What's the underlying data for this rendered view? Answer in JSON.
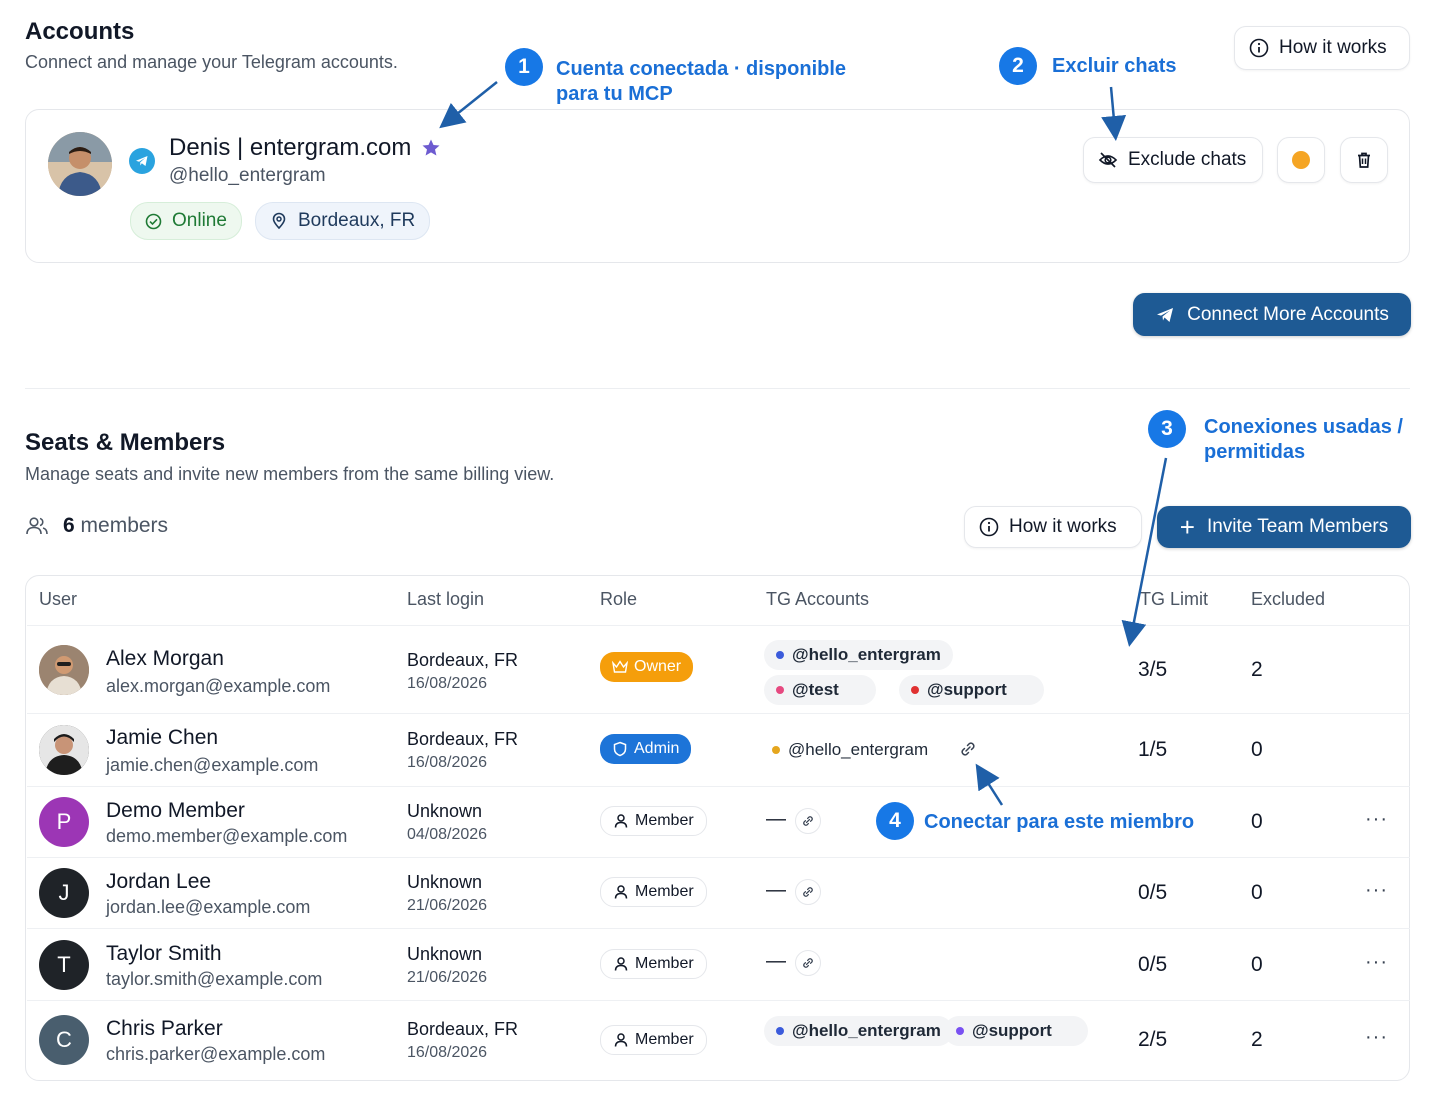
{
  "accounts": {
    "title": "Accounts",
    "subtitle": "Connect and manage your Telegram accounts.",
    "how_it_works": "How it works",
    "account": {
      "name": "Denis | entergram.com",
      "handle": "@hello_entergram",
      "status": "Online",
      "location": "Bordeaux, FR",
      "exclude_label": "Exclude chats",
      "status_color": "#f59e0b"
    },
    "connect_more": "Connect More Accounts"
  },
  "annotations": {
    "a1": {
      "num": "1",
      "line1": "Cuenta conectada · disponible",
      "line2": "para tu MCP"
    },
    "a2": {
      "num": "2",
      "line1": "Excluir chats"
    },
    "a3": {
      "num": "3",
      "line1": "Conexiones usadas /",
      "line2": "permitidas"
    },
    "a4": {
      "num": "4",
      "line1": "Conectar para este miembro"
    }
  },
  "seats": {
    "title": "Seats & Members",
    "subtitle": "Manage seats and invite new members from the same billing view.",
    "member_count": "6",
    "member_label": "members",
    "how_it_works": "How it works",
    "invite": "Invite Team Members",
    "columns": {
      "user": "User",
      "last_login": "Last login",
      "role": "Role",
      "tg_accounts": "TG Accounts",
      "tg_limit": "TG Limit",
      "excluded": "Excluded"
    },
    "rows": [
      {
        "name": "Alex Morgan",
        "email": "alex.morgan@example.com",
        "login_place": "Bordeaux, FR",
        "login_date": "16/08/2026",
        "role": "Owner",
        "tg": [
          "@hello_entergram",
          "@test",
          "@support"
        ],
        "limit": "3/5",
        "excluded": "2"
      },
      {
        "name": "Jamie Chen",
        "email": "jamie.chen@example.com",
        "login_place": "Bordeaux, FR",
        "login_date": "16/08/2026",
        "role": "Admin",
        "tg": [
          "@hello_entergram"
        ],
        "limit": "1/5",
        "excluded": "0"
      },
      {
        "name": "Demo Member",
        "initial": "P",
        "email": "demo.member@example.com",
        "login_place": "Unknown",
        "login_date": "04/08/2026",
        "role": "Member",
        "tg_empty": "—",
        "limit": "",
        "excluded": "0",
        "more": "···"
      },
      {
        "name": "Jordan Lee",
        "initial": "J",
        "email": "jordan.lee@example.com",
        "login_place": "Unknown",
        "login_date": "21/06/2026",
        "role": "Member",
        "tg_empty": "—",
        "limit": "0/5",
        "excluded": "0",
        "more": "···"
      },
      {
        "name": "Taylor Smith",
        "initial": "T",
        "email": "taylor.smith@example.com",
        "login_place": "Unknown",
        "login_date": "21/06/2026",
        "role": "Member",
        "tg_empty": "—",
        "limit": "0/5",
        "excluded": "0",
        "more": "···"
      },
      {
        "name": "Chris Parker",
        "initial": "C",
        "email": "chris.parker@example.com",
        "login_place": "Bordeaux, FR",
        "login_date": "16/08/2026",
        "role": "Member",
        "tg": [
          "@hello_entergram",
          "@support"
        ],
        "limit": "2/5",
        "excluded": "2",
        "more": "···"
      }
    ]
  },
  "colors": {
    "primary": "#1e5a94",
    "annotation": "#1778e6",
    "online_green": "#16a34a",
    "owner": "#f59e0b",
    "admin": "#1d74d8"
  }
}
